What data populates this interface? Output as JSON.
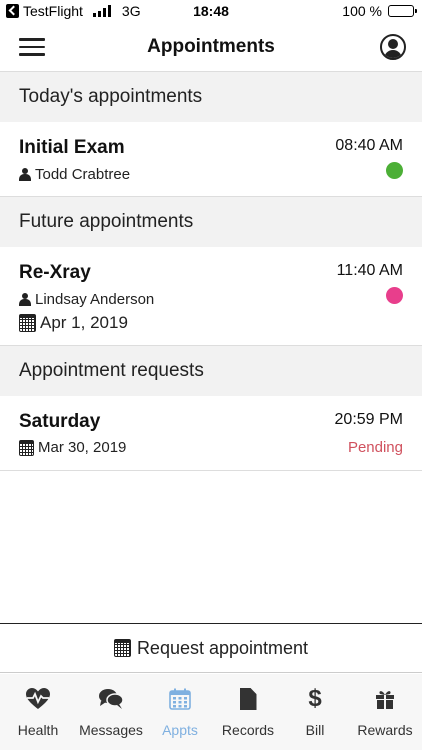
{
  "status_bar": {
    "carrier": "TestFlight",
    "network": "3G",
    "time": "18:48",
    "battery": "100 %"
  },
  "header": {
    "title": "Appointments"
  },
  "sections": {
    "today": {
      "title": "Today's appointments",
      "items": [
        {
          "title": "Initial Exam",
          "time": "08:40 AM",
          "provider": "Todd Crabtree",
          "status_color": "#4caf36"
        }
      ]
    },
    "future": {
      "title": "Future appointments",
      "items": [
        {
          "title": "Re-Xray",
          "time": "11:40 AM",
          "provider": "Lindsay Anderson",
          "date": "Apr 1, 2019",
          "status_color": "#e83e8c"
        }
      ]
    },
    "requests": {
      "title": "Appointment requests",
      "items": [
        {
          "title": "Saturday",
          "time": "20:59 PM",
          "date": "Mar 30, 2019",
          "status": "Pending",
          "status_color": "#d0515e"
        }
      ]
    }
  },
  "request_button": {
    "label": "Request appointment"
  },
  "tabs": [
    {
      "label": "Health",
      "icon": "heartbeat-icon"
    },
    {
      "label": "Messages",
      "icon": "chat-bubbles-icon"
    },
    {
      "label": "Appts",
      "icon": "calendar-icon",
      "active": true
    },
    {
      "label": "Records",
      "icon": "document-icon"
    },
    {
      "label": "Bill",
      "icon": "dollar-icon"
    },
    {
      "label": "Rewards",
      "icon": "gift-icon"
    }
  ],
  "colors": {
    "active_tab": "#7fb0e0",
    "section_bg": "#f2f2f2"
  }
}
